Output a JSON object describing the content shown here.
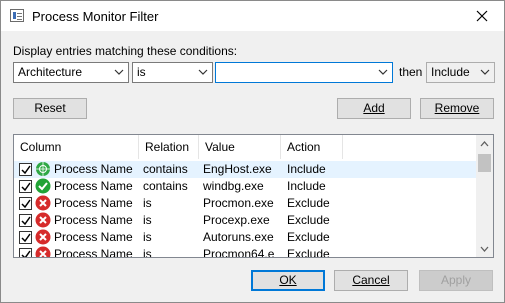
{
  "window": {
    "title": "Process Monitor Filter"
  },
  "filter": {
    "prompt": "Display entries matching these conditions:",
    "column_value": "Architecture",
    "relation_value": "is",
    "value_text": "",
    "then_label": "then",
    "action_value": "Include"
  },
  "buttons": {
    "reset": "Reset",
    "add": "Add",
    "remove": "Remove",
    "ok": "OK",
    "cancel": "Cancel",
    "apply": "Apply"
  },
  "table": {
    "headers": {
      "column": "Column",
      "relation": "Relation",
      "value": "Value",
      "action": "Action"
    },
    "rows": [
      {
        "checked": true,
        "icon": "globe-include-icon",
        "column": "Process Name",
        "relation": "contains",
        "value": "EngHost.exe",
        "action": "Include"
      },
      {
        "checked": true,
        "icon": "green-check-icon",
        "column": "Process Name",
        "relation": "contains",
        "value": "windbg.exe",
        "action": "Include"
      },
      {
        "checked": true,
        "icon": "red-x-icon",
        "column": "Process Name",
        "relation": "is",
        "value": "Procmon.exe",
        "action": "Exclude"
      },
      {
        "checked": true,
        "icon": "red-x-icon",
        "column": "Process Name",
        "relation": "is",
        "value": "Procexp.exe",
        "action": "Exclude"
      },
      {
        "checked": true,
        "icon": "red-x-icon",
        "column": "Process Name",
        "relation": "is",
        "value": "Autoruns.exe",
        "action": "Exclude"
      },
      {
        "checked": true,
        "icon": "red-x-icon",
        "column": "Process Name",
        "relation": "is",
        "value": "Procmon64.e",
        "action": "Exclude"
      }
    ]
  },
  "colors": {
    "accent": "#0078d7",
    "include_green": "#21a336",
    "exclude_red": "#d62b2b",
    "selected_row": "#e5f3ff"
  }
}
